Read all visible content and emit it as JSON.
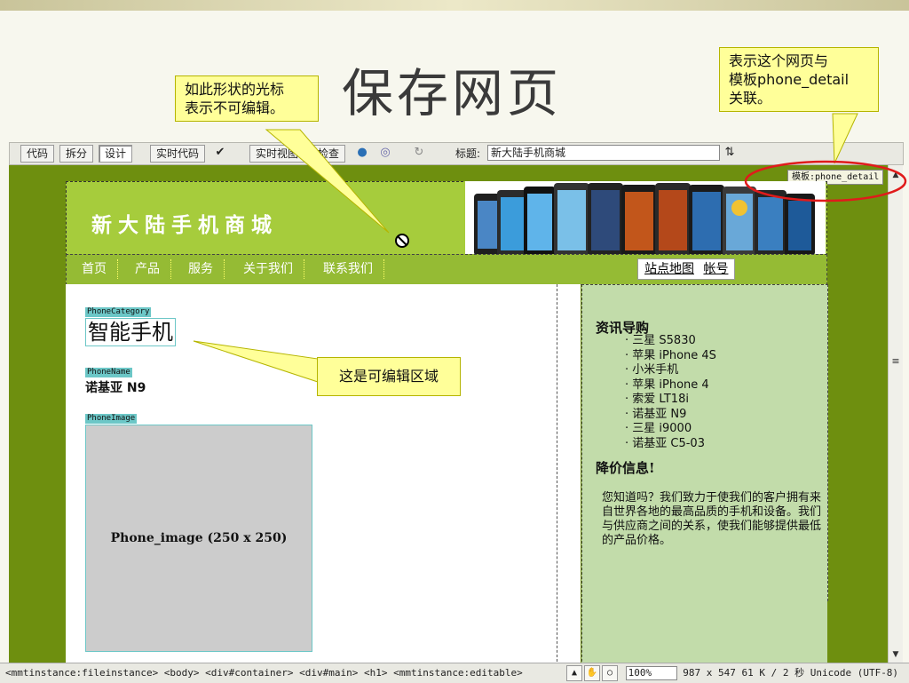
{
  "slide": {
    "title": "保存网页",
    "callout_cursor": "如此形状的光标表示不可编辑。",
    "callout_cursor_line1": "如此形状的光标",
    "callout_cursor_line2": "表示不可编辑。",
    "callout_template_line1": "表示这个网页与",
    "callout_template_line2": "模板phone_detail",
    "callout_template_line3": "关联。",
    "callout_editable": "这是可编辑区域"
  },
  "toolbar": {
    "code_label": "代码",
    "split_label": "拆分",
    "design_label": "设计",
    "live_code_label": "实时代码",
    "live_view_label": "实时视图",
    "inspect_label": "检查",
    "title_label": "标题:",
    "title_value": "新大陆手机商城"
  },
  "document": {
    "template_tab": "模板:phone_detail",
    "site_logo": "新大陆手机商城",
    "nav": [
      "首页",
      "产品",
      "服务",
      "关于我们",
      "联系我们"
    ],
    "nav_links": [
      "站点地图",
      "帐号"
    ],
    "region_category_tag": "PhoneCategory",
    "category_heading": "智能手机",
    "region_name_tag": "PhoneName",
    "phone_name": "诺基亚 N9",
    "region_image_tag": "PhoneImage",
    "image_placeholder": "Phone_image (250 x 250)"
  },
  "sidebar": {
    "news_heading": "资讯导购",
    "news_items": [
      "三星 S5830",
      "苹果 iPhone 4S",
      "小米手机",
      "苹果 iPhone 4",
      "索爱 LT18i",
      "诺基亚 N9",
      "三星 i9000",
      "诺基亚 C5-03"
    ],
    "price_heading": "降价信息!",
    "price_text": "您知道吗？我们致力于使我们的客户拥有来自世界各地的最高品质的手机和设备。我们与供应商之间的关系，使我们能够提供最低的产品价格。"
  },
  "status": {
    "tag_path": "<mmtinstance:fileinstance> <body> <div#container> <div#main> <h1> <mmtinstance:editable>",
    "zoom": "100%",
    "dimensions": "987 x 547",
    "file_info": "61 K / 2 秒",
    "encoding": "Unicode (UTF-8)"
  },
  "colors": {
    "page_bg": "#6e8f0f",
    "header_green": "#a6cc3c",
    "nav_green": "#95bb34",
    "sidebar_green": "#c2dcaa",
    "editable_tag": "#6cc7c7",
    "callout_yellow": "#ffff99",
    "highlight_red": "#e01b1b"
  }
}
